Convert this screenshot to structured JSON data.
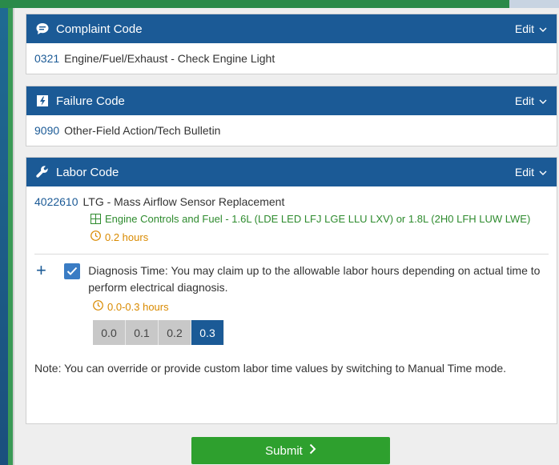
{
  "colors": {
    "header": "#1b5a96",
    "accent_green": "#2e8b2e",
    "accent_orange": "#d98a00",
    "submit": "#2ea02e"
  },
  "complaint": {
    "title": "Complaint Code",
    "icon": "chat-bubble-icon",
    "edit_label": "Edit",
    "code": "0321",
    "description": "Engine/Fuel/Exhaust - Check Engine Light"
  },
  "failure": {
    "title": "Failure Code",
    "icon": "lightning-document-icon",
    "edit_label": "Edit",
    "code": "9090",
    "description": "Other-Field Action/Tech Bulletin"
  },
  "labor": {
    "title": "Labor Code",
    "icon": "wrench-icon",
    "edit_label": "Edit",
    "code": "4022610",
    "description": "LTG - Mass Airflow Sensor Replacement",
    "vehicle": "Engine Controls and Fuel - 1.6L (LDE LED LFJ LGE LLU LXV) or 1.8L (2H0 LFH LUW LWE)",
    "hours": "0.2 hours",
    "diagnosis": {
      "checked": true,
      "text": "Diagnosis Time: You may claim up to the allowable labor hours depending on actual time to perform electrical diagnosis.",
      "range": "0.0-0.3 hours",
      "options": [
        "0.0",
        "0.1",
        "0.2",
        "0.3"
      ],
      "selected": "0.3"
    },
    "note": "Note: You can override or provide custom labor time values by switching to Manual Time mode."
  },
  "submit_label": "Submit"
}
